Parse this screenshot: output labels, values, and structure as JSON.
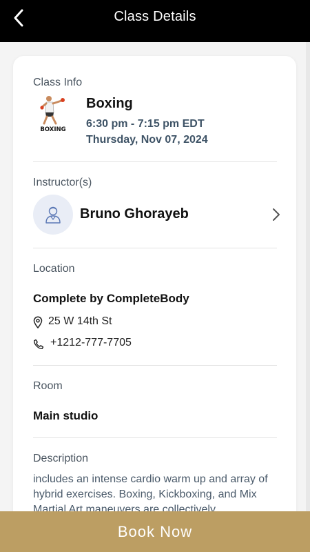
{
  "header": {
    "title": "Class Details",
    "back_icon": "chevron-left-icon"
  },
  "class_info": {
    "label": "Class Info",
    "name": "Boxing",
    "time": "6:30 pm - 7:15 pm EDT",
    "date": "Thursday, Nov 07, 2024",
    "thumbnail_text": "BOXING"
  },
  "instructor": {
    "label": "Instructor(s)",
    "name": "Bruno Ghorayeb",
    "avatar_icon": "user-icon",
    "chevron_icon": "chevron-right-icon"
  },
  "location": {
    "label": "Location",
    "name": "Complete by CompleteBody",
    "address": "25 W 14th St",
    "phone": "+1212-777-7705",
    "address_icon": "map-pin-icon",
    "phone_icon": "phone-icon"
  },
  "room": {
    "label": "Room",
    "name": "Main studio"
  },
  "description": {
    "label": "Description",
    "text": "includes an intense cardio warm up and array of hybrid exercises. Boxing, Kickboxing, and Mix Martial Art maneuvers are collectively"
  },
  "footer": {
    "book_label": "Book Now"
  },
  "colors": {
    "header_bg": "#000000",
    "accent_gold": "#bc9e63",
    "time_text": "#3e5366",
    "avatar_bg": "#e9edf6"
  }
}
